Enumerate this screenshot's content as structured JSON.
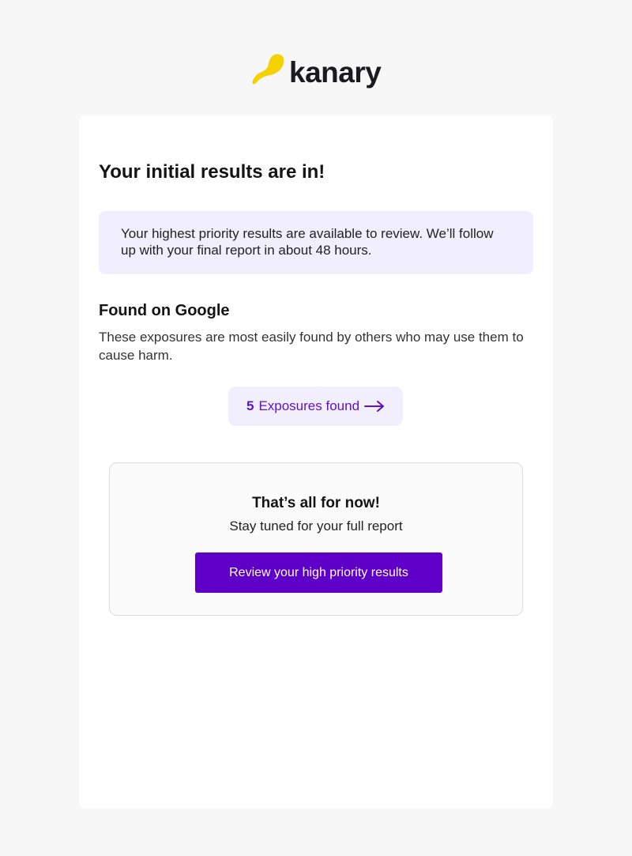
{
  "brand": {
    "name": "kanary",
    "logo_icon": "kanary-bird-icon",
    "logo_color": "#f5d100"
  },
  "card": {
    "headline": "Your initial results are in!",
    "notice": "Your highest priority results are available to review. We’ll follow up with your final report in about 48 hours.",
    "section": {
      "title": "Found on Google",
      "description": "These exposures are most easily found by others who may use them to cause harm."
    },
    "exposures": {
      "count": "5",
      "label": "Exposures found",
      "icon": "arrow-right-icon"
    },
    "final": {
      "title": "That’s all for now!",
      "subtitle": "Stay tuned for your full report",
      "button_label": "Review your high priority results"
    }
  },
  "colors": {
    "accent": "#5f00c9",
    "notice_bg": "#f1effd",
    "page_bg": "#f7f7f7"
  }
}
